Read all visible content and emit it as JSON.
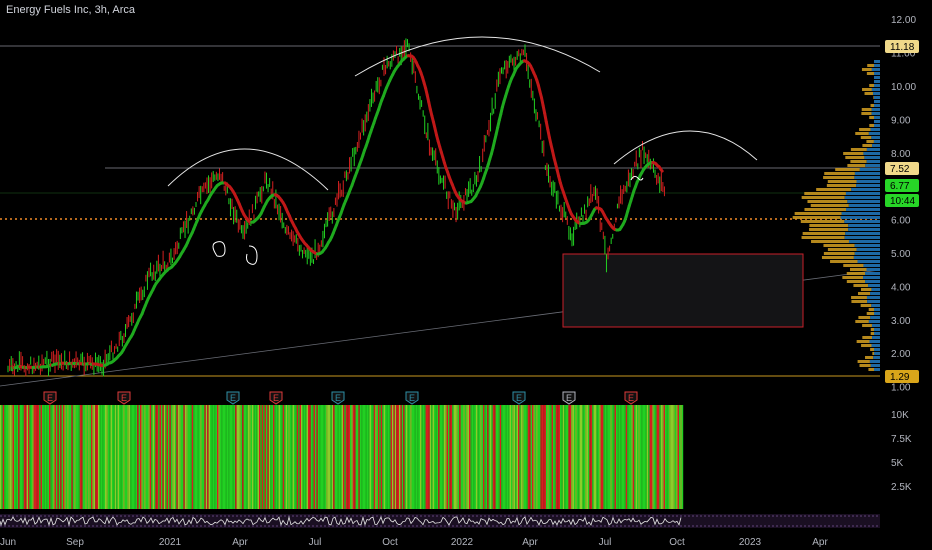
{
  "header": {
    "title": "Energy Fuels Inc, 3h, Arca"
  },
  "price_axis": {
    "ticks": [
      "12.00",
      "11.00",
      "10.00",
      "9.00",
      "8.00",
      "7.00",
      "6.00",
      "5.00",
      "4.00",
      "3.00",
      "2.00",
      "1.00"
    ],
    "labels": [
      {
        "value": "11.18",
        "bg": "#f0d98a",
        "fg": "#000000"
      },
      {
        "value": "7.52",
        "bg": "#f0d98a",
        "fg": "#000000"
      },
      {
        "value": "6.77",
        "bg": "#27d627",
        "fg": "#000000"
      },
      {
        "value": "10:44",
        "bg": "#27d627",
        "fg": "#000000"
      },
      {
        "value": "1.29",
        "bg": "#d9a51a",
        "fg": "#000000"
      }
    ]
  },
  "volume_axis": {
    "ticks": [
      "10K",
      "7.5K",
      "5K",
      "2.5K"
    ]
  },
  "time_axis": {
    "ticks": [
      "Jun",
      "Sep",
      "2021",
      "Apr",
      "Jul",
      "Oct",
      "2022",
      "Apr",
      "Jul",
      "Oct",
      "2023",
      "Apr"
    ]
  },
  "event_markers": [
    {
      "label": "E",
      "color": "#e03a3a"
    },
    {
      "label": "E",
      "color": "#e03a3a"
    },
    {
      "label": "E",
      "color": "#2e8fa6"
    },
    {
      "label": "E",
      "color": "#e03a3a"
    },
    {
      "label": "E",
      "color": "#2e8fa6"
    },
    {
      "label": "E",
      "color": "#2e8fa6"
    },
    {
      "label": "E",
      "color": "#2e8fa6"
    },
    {
      "label": "E",
      "color": "#b2b5be"
    },
    {
      "label": "E",
      "color": "#e03a3a"
    }
  ],
  "colors": {
    "up": "#22d022",
    "down": "#d42020",
    "ma_up": "#1faa1f",
    "ma_down": "#c01818",
    "vp_gold": "#c9971f",
    "vp_blue": "#1f6fae",
    "poc_line": "#f28c28",
    "box": "#c8202a"
  },
  "chart_data": {
    "type": "line",
    "title": "Energy Fuels Inc, 3h, Arca",
    "ylim": [
      1,
      12.6
    ],
    "key_levels": [
      11.18,
      7.52,
      6.0,
      1.29
    ],
    "current_price": 6.77,
    "price_path": [
      {
        "x": "2020-06",
        "y": 1.5
      },
      {
        "x": "2020-08",
        "y": 1.7
      },
      {
        "x": "2020-10",
        "y": 1.6
      },
      {
        "x": "2020-11",
        "y": 2.6
      },
      {
        "x": "2020-12",
        "y": 4.3
      },
      {
        "x": "2021-01",
        "y": 4.8
      },
      {
        "x": "2021-02",
        "y": 6.5
      },
      {
        "x": "2021-03",
        "y": 7.4
      },
      {
        "x": "2021-04",
        "y": 5.4
      },
      {
        "x": "2021-05",
        "y": 7.2
      },
      {
        "x": "2021-06",
        "y": 5.4
      },
      {
        "x": "2021-07",
        "y": 4.8
      },
      {
        "x": "2021-08",
        "y": 6.5
      },
      {
        "x": "2021-09",
        "y": 8.5
      },
      {
        "x": "2021-10",
        "y": 10.5
      },
      {
        "x": "2021-11",
        "y": 11.2
      },
      {
        "x": "2021-12",
        "y": 8.0
      },
      {
        "x": "2022-01",
        "y": 6.2
      },
      {
        "x": "2022-02",
        "y": 7.2
      },
      {
        "x": "2022-03",
        "y": 10.5
      },
      {
        "x": "2022-04",
        "y": 10.9
      },
      {
        "x": "2022-05",
        "y": 7.2
      },
      {
        "x": "2022-06",
        "y": 5.5
      },
      {
        "x": "2022-07",
        "y": 6.8
      },
      {
        "x": "2022-07-15",
        "y": 4.8
      },
      {
        "x": "2022-08",
        "y": 6.5
      },
      {
        "x": "2022-09",
        "y": 8.0
      },
      {
        "x": "2022-10",
        "y": 6.77
      }
    ]
  }
}
